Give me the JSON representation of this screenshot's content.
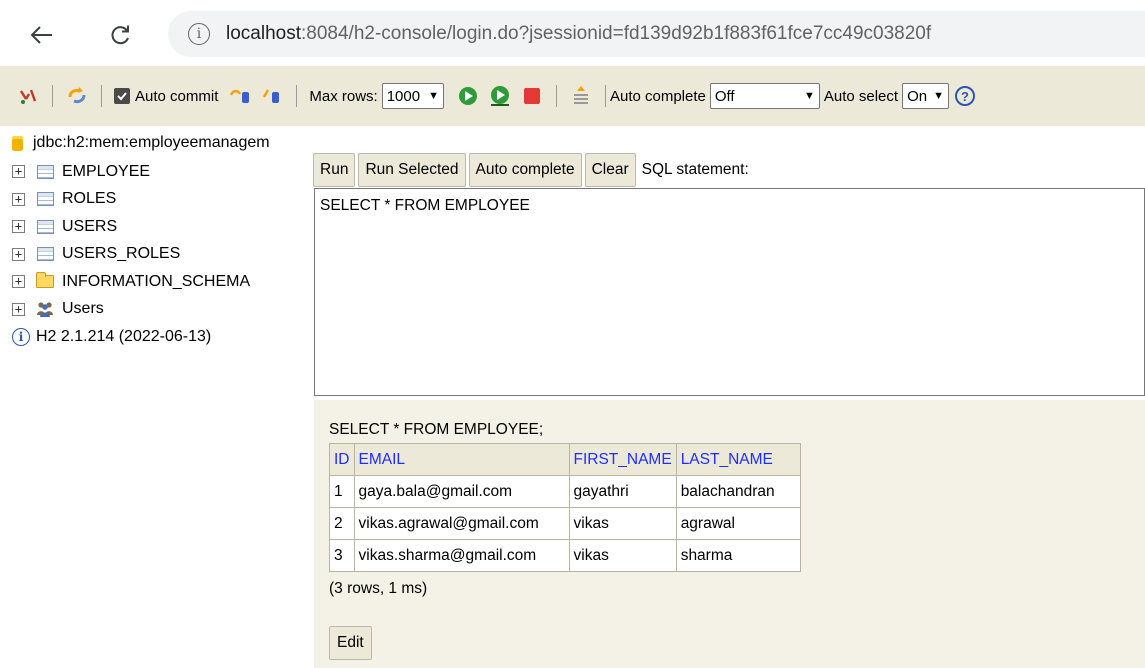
{
  "browser": {
    "url_info_icon": "info-icon",
    "url_host": "localhost",
    "url_rest": ":8084/h2-console/login.do?jsessionid=fd139d92b1f883f61fce7cc49c03820f"
  },
  "toolbar": {
    "auto_commit_label": "Auto commit",
    "auto_commit_checked": true,
    "max_rows_label": "Max rows:",
    "max_rows_value": "1000",
    "auto_complete_label": "Auto complete",
    "auto_complete_value": "Off",
    "auto_select_label": "Auto select",
    "auto_select_value": "On",
    "help_glyph": "?",
    "info_glyph": "i"
  },
  "tree": {
    "connection": "jdbc:h2:mem:employeemanagem",
    "items": [
      {
        "label": "EMPLOYEE",
        "icon": "table-icon"
      },
      {
        "label": "ROLES",
        "icon": "table-icon"
      },
      {
        "label": "USERS",
        "icon": "table-icon"
      },
      {
        "label": "USERS_ROLES",
        "icon": "table-icon"
      },
      {
        "label": "INFORMATION_SCHEMA",
        "icon": "folder-icon"
      },
      {
        "label": "Users",
        "icon": "users-icon"
      }
    ],
    "expander_glyph": "+",
    "version": "H2 2.1.214 (2022-06-13)"
  },
  "query": {
    "run_label": "Run",
    "run_selected_label": "Run Selected",
    "auto_complete_label": "Auto complete",
    "clear_label": "Clear",
    "sql_statement_label": "SQL statement:",
    "sql_text": "SELECT * FROM EMPLOYEE"
  },
  "result": {
    "sql": "SELECT * FROM EMPLOYEE;",
    "columns": [
      "ID",
      "EMAIL",
      "FIRST_NAME",
      "LAST_NAME"
    ],
    "rows": [
      [
        "1",
        "gaya.bala@gmail.com",
        "gayathri",
        "balachandran"
      ],
      [
        "2",
        "vikas.agrawal@gmail.com",
        "vikas",
        "agrawal"
      ],
      [
        "3",
        "vikas.sharma@gmail.com",
        "vikas",
        "sharma"
      ]
    ],
    "count": "(3 rows, 1 ms)",
    "edit_label": "Edit"
  },
  "colors": {
    "toolbar_bg": "#ece9d8",
    "result_bg": "#f4f2e6",
    "header_link": "#1f2dff"
  }
}
